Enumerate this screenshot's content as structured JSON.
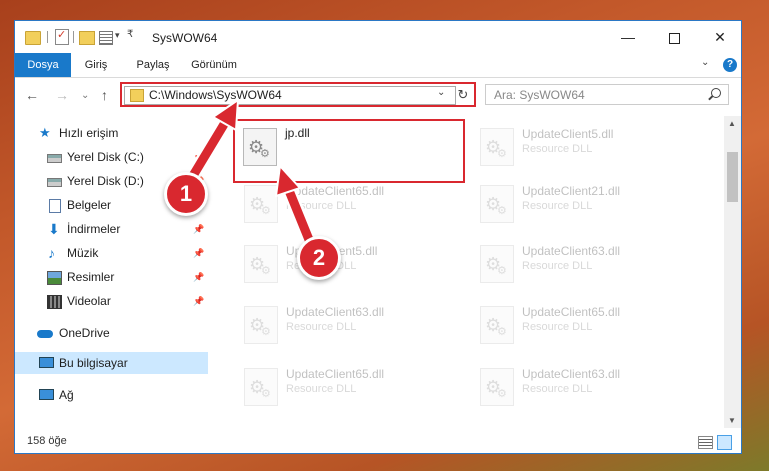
{
  "window": {
    "title": "SysWOW64",
    "controls": {
      "minimize": "—",
      "maximize": "",
      "close": "✕"
    }
  },
  "ribbon": {
    "tabs": [
      "Dosya",
      "Giriş",
      "Paylaş",
      "Görünüm"
    ],
    "help": "?"
  },
  "navigation": {
    "back": "←",
    "forward": "→",
    "recent": "⌄",
    "up": "↑",
    "address": "C:\\Windows\\SysWOW64",
    "refresh": "↻",
    "search_placeholder": "Ara: SysWOW64"
  },
  "sidebar": {
    "items": [
      {
        "label": "Hızlı erişim",
        "icon": "star-icon",
        "pinned": false
      },
      {
        "label": "Yerel Disk (C:)",
        "icon": "drive-icon",
        "pinned": true
      },
      {
        "label": "Yerel Disk (D:)",
        "icon": "drive-icon",
        "pinned": true
      },
      {
        "label": "Belgeler",
        "icon": "documents-icon",
        "pinned": true
      },
      {
        "label": "İndirmeler",
        "icon": "downloads-icon",
        "pinned": true
      },
      {
        "label": "Müzik",
        "icon": "music-icon",
        "pinned": true
      },
      {
        "label": "Resimler",
        "icon": "pictures-icon",
        "pinned": true
      },
      {
        "label": "Videolar",
        "icon": "videos-icon",
        "pinned": true
      },
      {
        "label": "OneDrive",
        "icon": "cloud-icon",
        "pinned": false
      },
      {
        "label": "Bu bilgisayar",
        "icon": "computer-icon",
        "pinned": false,
        "selected": true
      },
      {
        "label": "Ağ",
        "icon": "network-icon",
        "pinned": false
      }
    ]
  },
  "files": [
    {
      "name": "jp.dll",
      "type": "",
      "highlighted": true
    },
    {
      "name": "UpdateClient5.dll",
      "type": "Resource DLL"
    },
    {
      "name": "UpdateClient65.dll",
      "type": "Resource DLL"
    },
    {
      "name": "UpdateClient21.dll",
      "type": "Resource DLL"
    },
    {
      "name": "UpdateClient5.dll",
      "type": "Resource DLL"
    },
    {
      "name": "UpdateClient63.dll",
      "type": "Resource DLL"
    },
    {
      "name": "UpdateClient63.dll",
      "type": "Resource DLL"
    },
    {
      "name": "UpdateClient65.dll",
      "type": "Resource DLL"
    },
    {
      "name": "UpdateClient65.dll",
      "type": "Resource DLL"
    },
    {
      "name": "UpdateClient63.dll",
      "type": "Resource DLL"
    }
  ],
  "status": {
    "count": "158 öğe"
  },
  "callouts": {
    "one": "1",
    "two": "2"
  },
  "colors": {
    "accent": "#1979ca",
    "highlight": "#d9282f",
    "selection": "#cce8ff"
  }
}
